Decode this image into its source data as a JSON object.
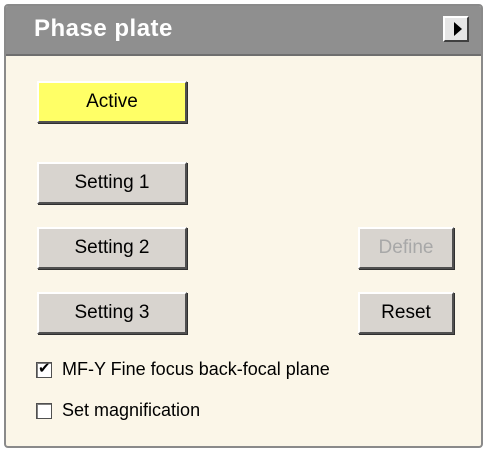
{
  "window": {
    "title": "Phase plate",
    "expand_icon": "right-arrow-icon"
  },
  "buttons": {
    "active": "Active",
    "setting1": "Setting 1",
    "setting2": "Setting 2",
    "setting3": "Setting 3",
    "define": "Define",
    "reset": "Reset"
  },
  "checkboxes": {
    "fine_focus": {
      "label": "MF-Y Fine focus back-focal plane",
      "checked": true,
      "mark": "✔"
    },
    "set_magnification": {
      "label": "Set magnification",
      "checked": false,
      "mark": ""
    }
  },
  "colors": {
    "active_button": "#ffff66",
    "title_bar": "#8f8f8f",
    "panel_background": "#fbf6e8",
    "disabled_text": "#a8a8a8"
  }
}
